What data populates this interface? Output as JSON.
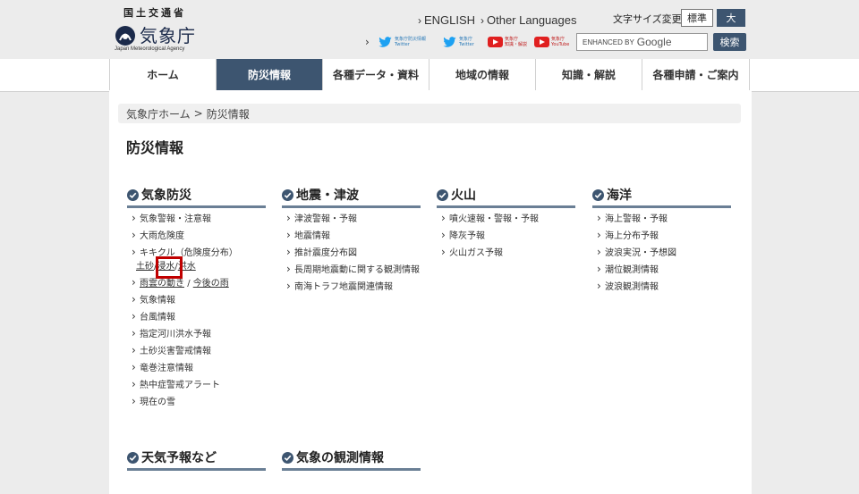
{
  "header": {
    "ministry": "国土交通省",
    "agency_name": "気象庁",
    "agency_en": "Japan Meteorological Agency",
    "lang_english": "ENGLISH",
    "lang_other": "Other Languages",
    "font_size_label": "文字サイズ変更",
    "font_std": "標準",
    "font_large": "大",
    "social": [
      {
        "icon": "twitter-bird",
        "line1": "気象庁防災情報",
        "line2": "Twitter"
      },
      {
        "icon": "twitter-bird",
        "line1": "気象庁",
        "line2": "Twitter"
      },
      {
        "icon": "youtube",
        "line1": "気象庁",
        "line2": "知識・解説"
      },
      {
        "icon": "youtube",
        "line1": "気象庁",
        "line2": "YouTube"
      }
    ],
    "search_prefix": "ENHANCED BY",
    "search_brand": "Google",
    "search_button": "検索"
  },
  "nav": {
    "items": [
      "ホーム",
      "防災情報",
      "各種データ・資料",
      "地域の情報",
      "知識・解説",
      "各種申請・ご案内"
    ],
    "active_index": 1
  },
  "breadcrumb": {
    "home": "気象庁ホーム",
    "sep": ">",
    "current": "防災情報"
  },
  "page_title": "防災情報",
  "sections": {
    "weather": {
      "title": "気象防災",
      "items": {
        "warnings": "気象警報・注意報",
        "heavy_rain": "大雨危険度",
        "kikikuru": "キキクル（危険度分布）",
        "kiki_landslide": "土砂",
        "kiki_sep1": "/",
        "kiki_inundation": "浸水",
        "kiki_sep2": "/",
        "kiki_flood": "洪水",
        "rain_cloud": "雨雲の動き",
        "rain_sep": "/",
        "future_rain": "今後の雨",
        "weather_info": "気象情報",
        "typhoon": "台風情報",
        "river_flood": "指定河川洪水予報",
        "landslide_alert": "土砂災害警戒情報",
        "tornado": "竜巻注意情報",
        "heatstroke": "熱中症警戒アラート",
        "snow": "現在の雪"
      }
    },
    "quake": {
      "title": "地震・津波",
      "items": [
        "津波警報・予報",
        "地震情報",
        "推計震度分布図",
        "長周期地震動に関する観測情報",
        "南海トラフ地震関連情報"
      ]
    },
    "volcano": {
      "title": "火山",
      "items": [
        "噴火速報・警報・予報",
        "降灰予報",
        "火山ガス予報"
      ]
    },
    "ocean": {
      "title": "海洋",
      "items": [
        "海上警報・予報",
        "海上分布予報",
        "波浪実況・予想図",
        "潮位観測情報",
        "波浪観測情報"
      ]
    },
    "forecast": {
      "title": "天気予報など"
    },
    "observation": {
      "title": "気象の観測情報"
    }
  },
  "colors": {
    "nav_active": "#3d5570",
    "highlight": "#c00000",
    "twitter": "#1da1f2",
    "youtube": "#e02020"
  }
}
